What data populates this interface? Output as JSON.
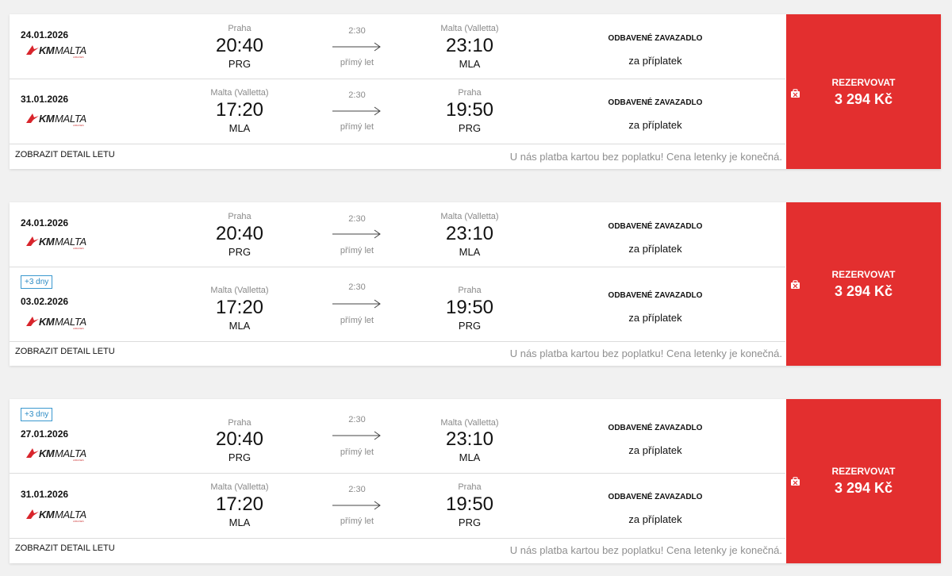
{
  "results": [
    {
      "legs": [
        {
          "badge": "",
          "date": "24.01.2026",
          "airline": {
            "km": "KM",
            "malta": "MALTA",
            "airlines": "AIRLINES"
          },
          "dep": {
            "city": "Praha",
            "time": "20:40",
            "code": "PRG"
          },
          "duration": "2:30",
          "direct": "přímý let",
          "arr": {
            "city": "Malta (Valletta)",
            "time": "23:10",
            "code": "MLA"
          },
          "baggage": "ODBAVENÉ ZAVAZADLO",
          "baggage_note": "za příplatek"
        },
        {
          "badge": "",
          "date": "31.01.2026",
          "airline": {
            "km": "KM",
            "malta": "MALTA",
            "airlines": "AIRLINES"
          },
          "dep": {
            "city": "Malta (Valletta)",
            "time": "17:20",
            "code": "MLA"
          },
          "duration": "2:30",
          "direct": "přímý let",
          "arr": {
            "city": "Praha",
            "time": "19:50",
            "code": "PRG"
          },
          "baggage": "ODBAVENÉ ZAVAZADLO",
          "baggage_note": "za příplatek"
        }
      ],
      "detail_link": "ZOBRAZIT DETAIL LETU",
      "payment_note": "U nás platba kartou bez poplatku! Cena letenky je konečná.",
      "book_label": "REZERVOVAT",
      "price": "3 294 Kč"
    },
    {
      "legs": [
        {
          "badge": "",
          "date": "24.01.2026",
          "airline": {
            "km": "KM",
            "malta": "MALTA",
            "airlines": "AIRLINES"
          },
          "dep": {
            "city": "Praha",
            "time": "20:40",
            "code": "PRG"
          },
          "duration": "2:30",
          "direct": "přímý let",
          "arr": {
            "city": "Malta (Valletta)",
            "time": "23:10",
            "code": "MLA"
          },
          "baggage": "ODBAVENÉ ZAVAZADLO",
          "baggage_note": "za příplatek"
        },
        {
          "badge": "+3 dny",
          "date": "03.02.2026",
          "airline": {
            "km": "KM",
            "malta": "MALTA",
            "airlines": "AIRLINES"
          },
          "dep": {
            "city": "Malta (Valletta)",
            "time": "17:20",
            "code": "MLA"
          },
          "duration": "2:30",
          "direct": "přímý let",
          "arr": {
            "city": "Praha",
            "time": "19:50",
            "code": "PRG"
          },
          "baggage": "ODBAVENÉ ZAVAZADLO",
          "baggage_note": "za příplatek"
        }
      ],
      "detail_link": "ZOBRAZIT DETAIL LETU",
      "payment_note": "U nás platba kartou bez poplatku! Cena letenky je konečná.",
      "book_label": "REZERVOVAT",
      "price": "3 294 Kč"
    },
    {
      "legs": [
        {
          "badge": "+3 dny",
          "date": "27.01.2026",
          "airline": {
            "km": "KM",
            "malta": "MALTA",
            "airlines": "AIRLINES"
          },
          "dep": {
            "city": "Praha",
            "time": "20:40",
            "code": "PRG"
          },
          "duration": "2:30",
          "direct": "přímý let",
          "arr": {
            "city": "Malta (Valletta)",
            "time": "23:10",
            "code": "MLA"
          },
          "baggage": "ODBAVENÉ ZAVAZADLO",
          "baggage_note": "za příplatek"
        },
        {
          "badge": "",
          "date": "31.01.2026",
          "airline": {
            "km": "KM",
            "malta": "MALTA",
            "airlines": "AIRLINES"
          },
          "dep": {
            "city": "Malta (Valletta)",
            "time": "17:20",
            "code": "MLA"
          },
          "duration": "2:30",
          "direct": "přímý let",
          "arr": {
            "city": "Praha",
            "time": "19:50",
            "code": "PRG"
          },
          "baggage": "ODBAVENÉ ZAVAZADLO",
          "baggage_note": "za příplatek"
        }
      ],
      "detail_link": "ZOBRAZIT DETAIL LETU",
      "payment_note": "U nás platba kartou bez poplatku! Cena letenky je konečná.",
      "book_label": "REZERVOVAT",
      "price": "3 294 Kč"
    }
  ],
  "colors": {
    "accent": "#e32f2f",
    "badge": "#3a98cf"
  },
  "icons": {
    "airline_logo": "km-malta-logo",
    "luggage": "luggage-icon",
    "arrow": "arrow-right-icon"
  }
}
